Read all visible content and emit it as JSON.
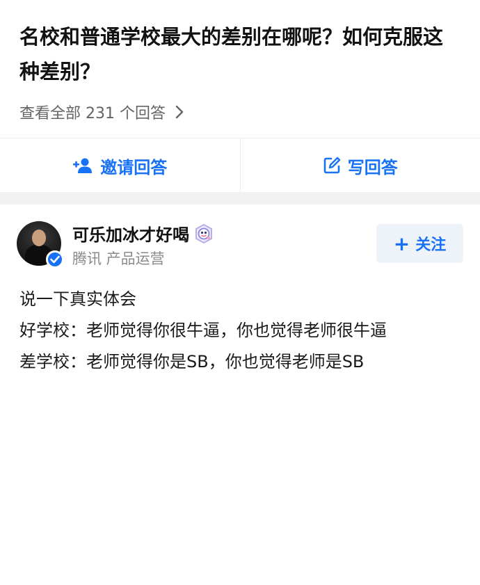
{
  "question": {
    "title": "名校和普通学校最大的差别在哪呢？如何克服这种差别？",
    "view_all_label": "查看全部 231 个回答"
  },
  "actions": {
    "invite_label": "邀请回答",
    "write_label": "写回答"
  },
  "answer": {
    "author_name": "可乐加冰才好喝",
    "author_desc": "腾讯 产品运营",
    "follow_label": "关注",
    "content": [
      "说一下真实体会",
      "好学校：老师觉得你很牛逼，你也觉得老师很牛逼",
      "差学校：老师觉得你是SB，你也觉得老师是SB"
    ]
  },
  "icons": {
    "view_all_chevron": "chevron-right-icon",
    "invite": "add-user-icon",
    "write": "edit-icon",
    "verified": "verified-check-icon",
    "badge": "user-badge-icon",
    "follow": "plus-icon"
  },
  "colors": {
    "accent": "#1772f6",
    "follow_bg": "#eef3f9",
    "divider_band": "#f1f1f1",
    "secondary_text": "#646464"
  }
}
